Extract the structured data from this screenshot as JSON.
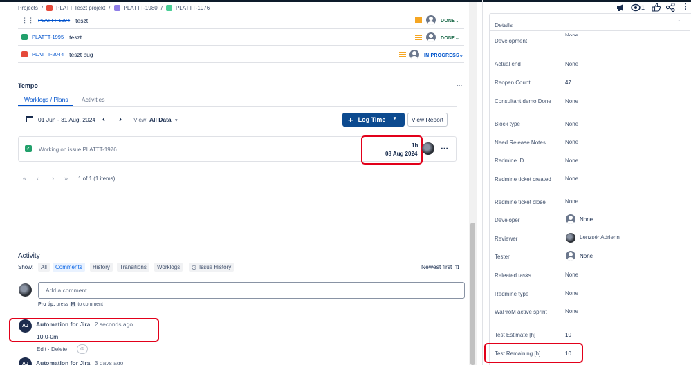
{
  "breadcrumb": {
    "projects": "Projects",
    "project": "PLATT Teszt projekt",
    "parent": "PLATTT-1980",
    "current": "PLATTT-1976",
    "sep": "/"
  },
  "toolbar": {
    "watch_count": "1"
  },
  "subtasks": [
    {
      "key": "PLATTT-1994",
      "summary": "teszt",
      "status": "DONE",
      "color": "#6b778c"
    },
    {
      "key": "PLATTT-1995",
      "summary": "teszt",
      "status": "DONE",
      "color": "#22a06b"
    },
    {
      "key": "PLATTT-2044",
      "summary": "teszt bug",
      "status": "IN PROGRESS",
      "color": "#e5493a"
    }
  ],
  "tempo": {
    "title": "Tempo",
    "more": "...",
    "tabs": [
      "Worklogs / Plans",
      "Activities"
    ],
    "date_range": "01 Jun - 31 Aug, 2024",
    "view_label": "View:",
    "view_value": "All Data",
    "log_time": "Log Time",
    "view_report": "View Report",
    "worklog": {
      "description": "Working on issue PLATTT-1976",
      "duration": "1h",
      "date": "08 Aug 2024"
    },
    "pagination": "1 of 1 (1 items)"
  },
  "activity": {
    "title": "Activity",
    "show_label": "Show:",
    "filters": [
      "All",
      "Comments",
      "History",
      "Transitions",
      "Worklogs",
      "Issue History"
    ],
    "active_filter": "Comments",
    "sort": "Newest first",
    "comment_placeholder": "Add a comment...",
    "pro_tip_prefix": "Pro tip:",
    "pro_tip_text": "press",
    "pro_tip_key": "M",
    "pro_tip_suffix": "to comment",
    "comments": [
      {
        "initials": "AJ",
        "author": "Automation for Jira",
        "time": "2 seconds ago",
        "body": "10.0-0m",
        "edit": "Edit",
        "dot": "·",
        "delete": "Delete"
      },
      {
        "initials": "AJ",
        "author": "Automation for Jira",
        "time": "3 days ago"
      }
    ]
  },
  "details": {
    "title": "Details",
    "truncated_field": "Development",
    "truncated_value": "None",
    "fields": [
      {
        "name": "Actual end",
        "value": "None"
      },
      {
        "name": "Reopen Count",
        "value": "47"
      },
      {
        "name": "Consultant demo Done",
        "value": "None"
      },
      {
        "name": "Block type",
        "value": "None"
      },
      {
        "name": "Need Release Notes",
        "value": "None"
      },
      {
        "name": "Redmine ID",
        "value": "None"
      },
      {
        "name": "Redmine ticket created",
        "value": "None"
      },
      {
        "name": "Redmine ticket close",
        "value": "None"
      },
      {
        "name": "Developer",
        "value": "None"
      },
      {
        "name": "Reviewer",
        "value": "Lenzsér Adrienn"
      },
      {
        "name": "Tester",
        "value": "None"
      },
      {
        "name": "Releated tasks",
        "value": "None"
      },
      {
        "name": "Redmine type",
        "value": "None"
      },
      {
        "name": "WaProM active sprint",
        "value": "None"
      },
      {
        "name": "Test Estimate [h]",
        "value": "10"
      },
      {
        "name": "Test Remaining [h]",
        "value": "10"
      }
    ]
  }
}
